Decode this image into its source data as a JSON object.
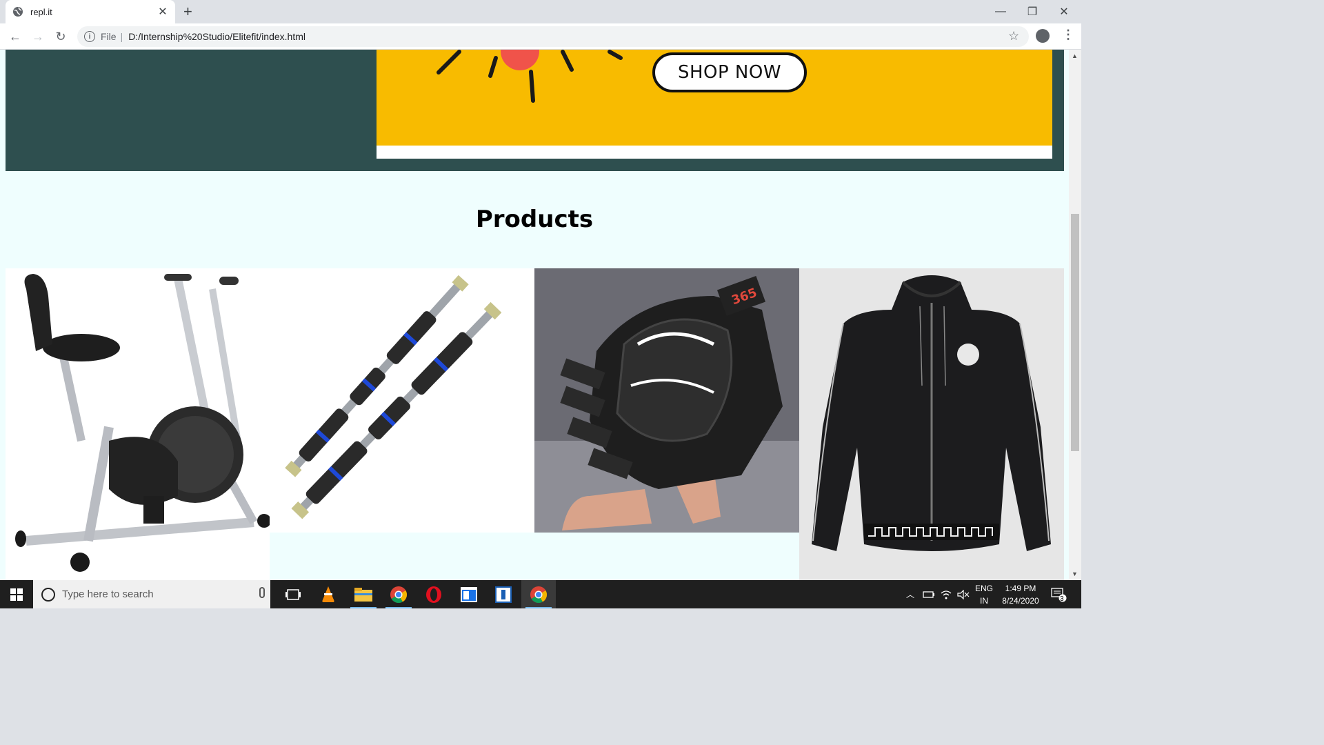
{
  "browser": {
    "tab_title": "repl.it",
    "tab_icon": "globe-icon",
    "address_scheme": "File",
    "address_url": "D:/Internship%20Studio/Elitefit/index.html"
  },
  "page": {
    "shop_now_label": "SHOP NOW",
    "products_heading": "Products",
    "products": [
      {
        "name": "exercise-bike-image"
      },
      {
        "name": "pull-up-bars-image"
      },
      {
        "name": "gym-gloves-image"
      },
      {
        "name": "hoodie-jacket-image"
      }
    ],
    "colors": {
      "hero_bg": "#2e4f4f",
      "banner_yellow": "#f8bb00",
      "page_bg": "#effefe"
    }
  },
  "taskbar": {
    "search_placeholder": "Type here to search",
    "lang_line1": "ENG",
    "lang_line2": "IN",
    "time": "1:49 PM",
    "date": "8/24/2020",
    "notification_count": "3"
  }
}
